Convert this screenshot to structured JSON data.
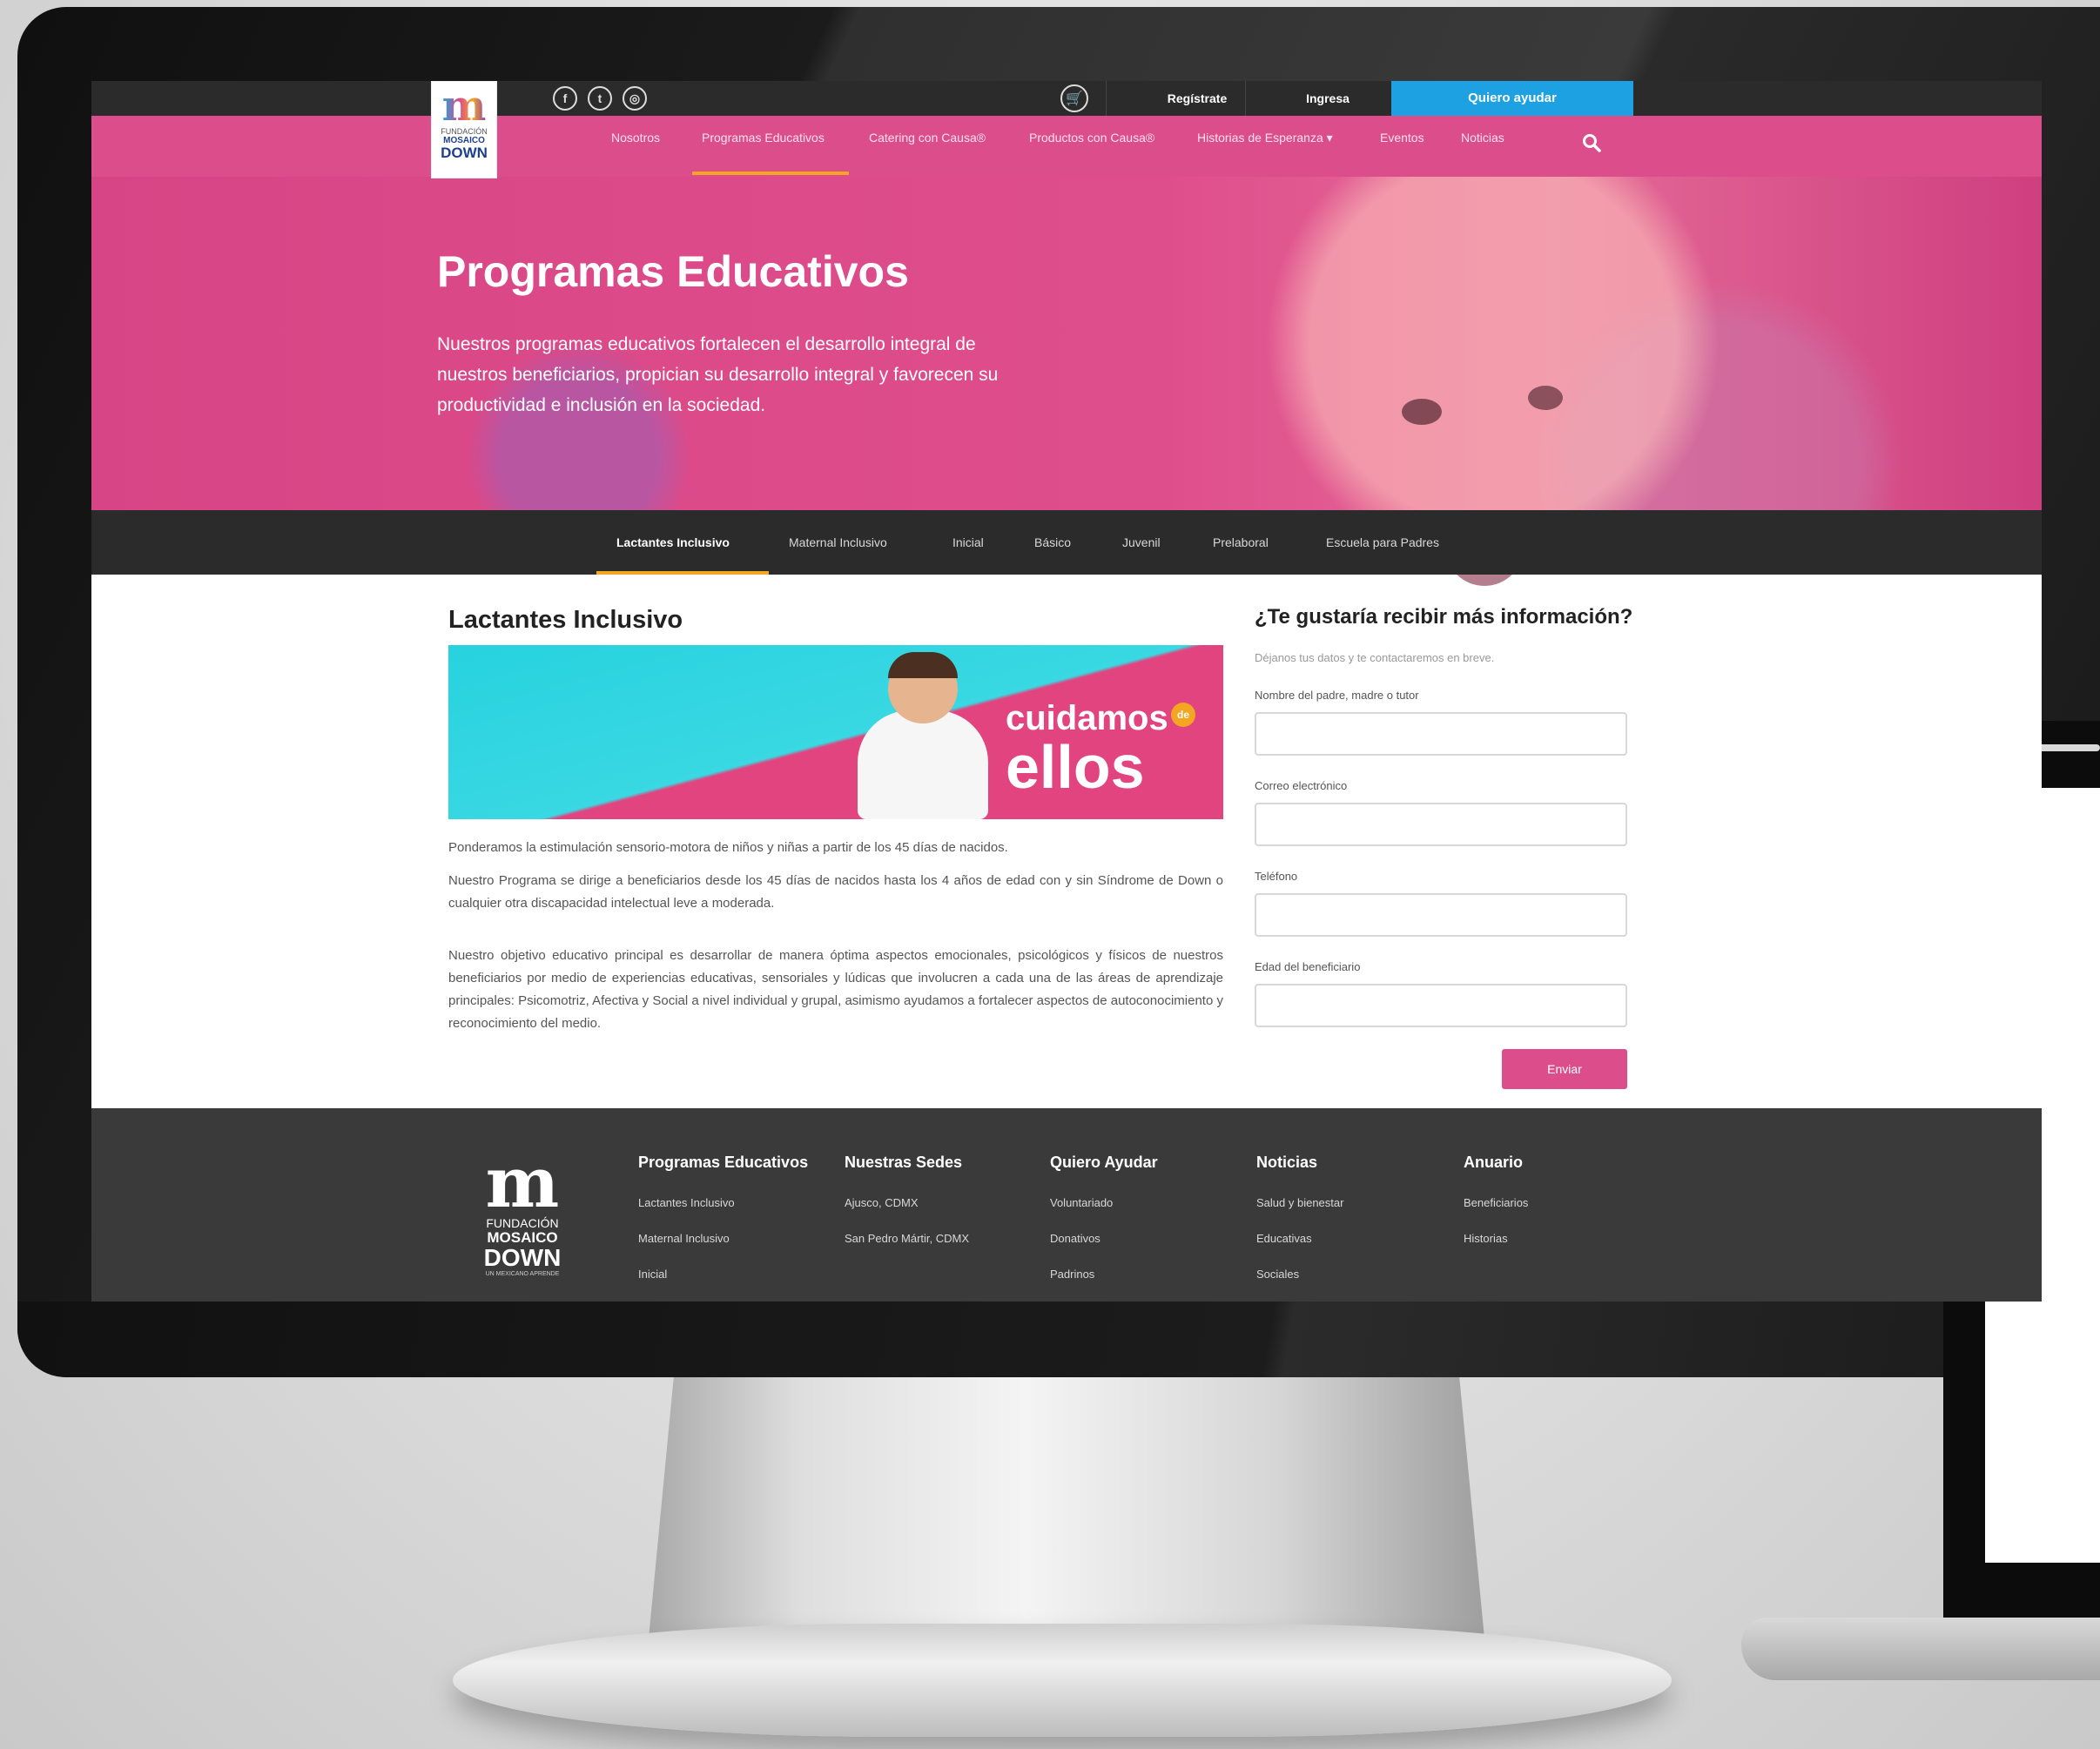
{
  "topbar": {
    "social_icons": [
      "facebook-icon",
      "twitter-icon",
      "instagram-icon"
    ],
    "cart_icon": "cart-icon",
    "register_label": "Regístrate",
    "login_label": "Ingresa",
    "help_label": "Quiero ayudar",
    "help_color": "#1da1e3"
  },
  "logo": {
    "line1": "FUNDACIÓN",
    "line2": "MOSAICO",
    "line3": "DOWN",
    "tagline": "UN MEXICANO APRENDE"
  },
  "mainnav": {
    "color": "#dc4d8b",
    "items": [
      "Nosotros",
      "Programas Educativos",
      "Catering con Causa®",
      "Productos con Causa®",
      "Historias de Esperanza ▾",
      "Eventos",
      "Noticias"
    ],
    "active_index": 1,
    "search_icon": "search-icon"
  },
  "hero": {
    "title": "Programas Educativos",
    "description": "Nuestros programas educativos fortalecen el desarrollo integral de nuestros beneficiarios, propician su desarrollo integral y favorecen su productividad e inclusión en la sociedad."
  },
  "subnav": {
    "items": [
      "Lactantes Inclusivo",
      "Maternal Inclusivo",
      "Inicial",
      "Básico",
      "Juvenil",
      "Prelaboral",
      "Escuela para Padres"
    ],
    "active_index": 0,
    "accent": "#f4a623"
  },
  "content": {
    "title": "Lactantes Inclusivo",
    "banner": {
      "word1": "cuidamos",
      "de": "de",
      "word2": "ellos"
    },
    "paragraphs": [
      "Ponderamos la estimulación sensorio-motora de niños y niñas a partir de los 45 días de nacidos.",
      "Nuestro Programa se dirige a beneficiarios desde los 45 días de nacidos hasta los 4 años de edad con y sin Síndrome de Down o cualquier otra discapacidad intelectual leve a moderada.",
      "Nuestro objetivo educativo principal es desarrollar de manera óptima aspectos emocionales, psicológicos y físicos de nuestros beneficiarios por medio de experiencias educativas, sensoriales y lúdicas que involucren a cada una de las áreas de aprendizaje principales: Psicomotriz, Afectiva y Social a nivel individual y grupal, asimismo ayudamos a fortalecer aspectos de autoconocimiento y reconocimiento del medio."
    ]
  },
  "form": {
    "title": "¿Te gustaría recibir más información?",
    "subtitle": "Déjanos tus datos y te contactaremos en breve.",
    "fields": [
      {
        "label": "Nombre del padre, madre o tutor",
        "value": ""
      },
      {
        "label": "Correo electrónico",
        "value": ""
      },
      {
        "label": "Teléfono",
        "value": ""
      },
      {
        "label": "Edad del beneficiario",
        "value": ""
      }
    ],
    "submit_label": "Enviar"
  },
  "footer": {
    "logo": {
      "line1": "FUNDACIÓN",
      "line2": "MOSAICO",
      "line3": "DOWN",
      "tagline": "UN MEXICANO APRENDE"
    },
    "columns": [
      {
        "title": "Programas Educativos",
        "links": [
          "Lactantes Inclusivo",
          "Maternal Inclusivo",
          "Inicial"
        ]
      },
      {
        "title": "Nuestras Sedes",
        "links": [
          "Ajusco, CDMX",
          "San Pedro Mártir, CDMX"
        ]
      },
      {
        "title": "Quiero Ayudar",
        "links": [
          "Voluntariado",
          "Donativos",
          "Padrinos"
        ]
      },
      {
        "title": "Noticias",
        "links": [
          "Salud y bienestar",
          "Educativas",
          "Sociales"
        ]
      },
      {
        "title": "Anuario",
        "links": [
          "Beneficiarios",
          "Historias"
        ]
      }
    ]
  }
}
